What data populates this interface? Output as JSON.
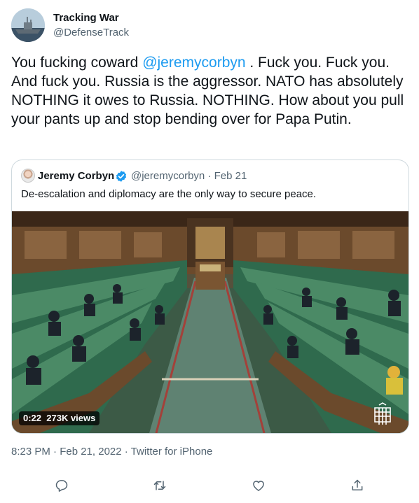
{
  "author": {
    "name": "Tracking War",
    "handle": "@DefenseTrack"
  },
  "tweet": {
    "text_before": "You fucking coward ",
    "mention": "@jeremycorbyn",
    "text_after": " . Fuck you. Fuck you. And fuck you. Russia is the aggressor. NATO has absolutely NOTHING it owes to Russia. NOTHING. How about you pull your pants up and stop bending over for Papa Putin."
  },
  "quoted": {
    "name": "Jeremy Corbyn",
    "meta": "@jeremycorbyn · Feb 21",
    "text": "De-escalation and diplomacy are the only way to secure peace.",
    "video": {
      "duration": "0:22",
      "views": "273K views"
    }
  },
  "footer": {
    "timestamp": "8:23 PM · Feb 21, 2022 · Twitter for iPhone"
  },
  "actions": [
    {
      "icon": "reply-icon"
    },
    {
      "icon": "retweet-icon"
    },
    {
      "icon": "like-icon"
    },
    {
      "icon": "share-icon"
    }
  ],
  "colors": {
    "text": "#0f1419",
    "secondary": "#536471",
    "accent": "#1d9bf0",
    "border": "#cfd9de"
  }
}
